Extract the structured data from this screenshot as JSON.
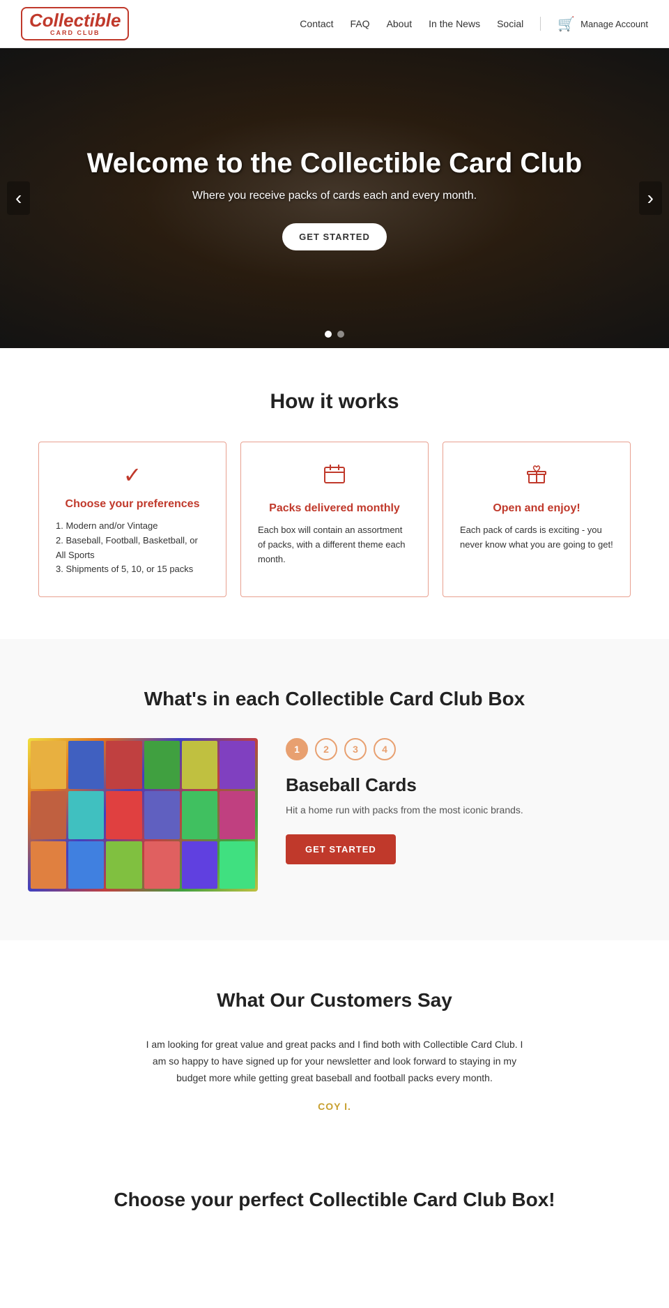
{
  "header": {
    "logo_line1": "Collectible",
    "logo_line2": "CARD CLUB",
    "nav": [
      {
        "label": "Contact",
        "id": "contact"
      },
      {
        "label": "FAQ",
        "id": "faq"
      },
      {
        "label": "About",
        "id": "about"
      },
      {
        "label": "In the News",
        "id": "in-the-news"
      },
      {
        "label": "Social",
        "id": "social"
      }
    ],
    "manage_account": "Manage Account"
  },
  "hero": {
    "title": "Welcome to the Collectible Card Club",
    "subtitle": "Where you receive packs of cards each and every month.",
    "cta": "GET STARTED",
    "dot1_active": true,
    "dot2_active": false
  },
  "how_it_works": {
    "heading": "How it works",
    "cards": [
      {
        "icon": "checkmark",
        "title": "Choose your preferences",
        "body": "1. Modern and/or Vintage\n2. Baseball, Football, Basketball, or All Sports\n3. Shipments of 5, 10, or 15 packs"
      },
      {
        "icon": "calendar",
        "title": "Packs delivered monthly",
        "body": "Each box will contain an assortment of packs, with a different theme each month."
      },
      {
        "icon": "gift",
        "title": "Open and enjoy!",
        "body": "Each pack of cards is exciting - you never know what you are going to get!"
      }
    ]
  },
  "whats_in": {
    "heading": "What's in each Collectible Card Club Box",
    "steps": [
      "1",
      "2",
      "3",
      "4"
    ],
    "active_step": 0,
    "active_title": "Baseball Cards",
    "active_desc": "Hit a home run with packs from the most iconic brands.",
    "cta": "GET STARTED"
  },
  "customers_say": {
    "heading": "What Our Customers Say",
    "testimonial": "I am looking for great value and great packs and I find both with Collectible Card Club. I am so happy to have signed up for your newsletter and look forward to staying in my budget more while getting great baseball and football packs every month.",
    "author": "COY I."
  },
  "choose_box": {
    "heading": "Choose your perfect Collectible Card Club Box!"
  }
}
